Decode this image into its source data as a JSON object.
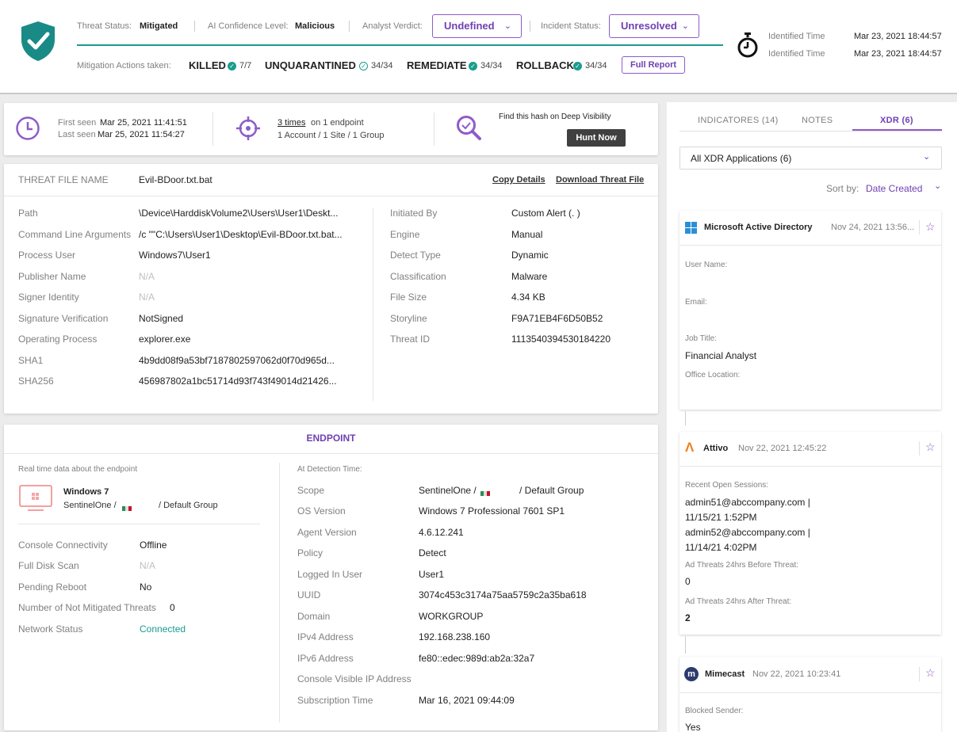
{
  "header": {
    "threat_status_label": "Threat Status:",
    "threat_status_value": "Mitigated",
    "ai_confidence_label": "AI Confidence Level:",
    "ai_confidence_value": "Malicious",
    "analyst_verdict_label": "Analyst Verdict:",
    "analyst_verdict_value": "Undefined",
    "incident_status_label": "Incident Status:",
    "incident_status_value": "Unresolved",
    "mitigation_label": "Mitigation Actions taken:",
    "mitigations": [
      {
        "name": "KILLED",
        "count": "7/7"
      },
      {
        "name": "UNQUARANTINED",
        "count": "34/34"
      },
      {
        "name": "REMEDIATE",
        "count": "34/34"
      },
      {
        "name": "ROLLBACK",
        "count": "34/34"
      }
    ],
    "full_report_label": "Full Report",
    "identified_label_1": "Identified Time",
    "identified_value_1": "Mar 23, 2021 18:44:57",
    "identified_label_2": "Identified Time",
    "identified_value_2": "Mar 23, 2021 18:44:57"
  },
  "summary": {
    "first_seen_label": "First seen",
    "first_seen_value": "Mar 25, 2021 11:41:51",
    "last_seen_label": "Last seen",
    "last_seen_value": "Mar 25, 2021 11:54:27",
    "times_link": "3 times",
    "times_suffix": "on 1 endpoint",
    "scope_line": "1 Account / 1 Site / 1 Group",
    "deep_visibility_text": "Find this hash on Deep Visibility",
    "hunt_now_label": "Hunt Now"
  },
  "threat_file": {
    "name_label": "THREAT FILE NAME",
    "name_value": "Evil-BDoor.txt.bat",
    "copy_details": "Copy Details",
    "download_file": "Download Threat File",
    "left_rows": [
      {
        "label": "Path",
        "value": "\\Device\\HarddiskVolume2\\Users\\User1\\Deskt..."
      },
      {
        "label": "Command Line Arguments",
        "value": "/c \"\"C:\\Users\\User1\\Desktop\\Evil-BDoor.txt.bat..."
      },
      {
        "label": "Process User",
        "value": "Windows7\\User1"
      },
      {
        "label": "Publisher Name",
        "value": "N/A"
      },
      {
        "label": "Signer Identity",
        "value": "N/A"
      },
      {
        "label": "Signature Verification",
        "value": "NotSigned"
      },
      {
        "label": "Operating Process",
        "value": "explorer.exe"
      },
      {
        "label": "SHA1",
        "value": "4b9dd08f9a53bf7187802597062d0f70d965d..."
      },
      {
        "label": "SHA256",
        "value": "456987802a1bc51714d93f743f49014d21426..."
      }
    ],
    "right_rows": [
      {
        "label": "Initiated By",
        "value": "Custom Alert (.                    )"
      },
      {
        "label": "Engine",
        "value": "Manual"
      },
      {
        "label": "Detect Type",
        "value": "Dynamic"
      },
      {
        "label": "Classification",
        "value": "Malware"
      },
      {
        "label": "File Size",
        "value": "4.34 KB"
      },
      {
        "label": "Storyline",
        "value": "F9A71EB4F6D50B52"
      },
      {
        "label": "Threat ID",
        "value": "1113540394530184220"
      }
    ]
  },
  "endpoint": {
    "title": "ENDPOINT",
    "realtime_label": "Real time data about the endpoint",
    "os_name": "Windows 7",
    "site_prefix": "SentinelOne /",
    "site_suffix": "/ Default Group",
    "left_rows": [
      {
        "label": "Console Connectivity",
        "value": "Offline"
      },
      {
        "label": "Full Disk Scan",
        "value": "N/A"
      },
      {
        "label": "Pending Reboot",
        "value": "No"
      },
      {
        "label": "Number of Not Mitigated Threats",
        "value": "0"
      },
      {
        "label": "Network Status",
        "value": "Connected"
      }
    ],
    "detection_label": "At Detection Time:",
    "right_rows": [
      {
        "label": "Scope",
        "value": "SentinelOne /"
      },
      {
        "label": "OS Version",
        "value": "Windows 7 Professional 7601 SP1"
      },
      {
        "label": "Agent Version",
        "value": "4.6.12.241"
      },
      {
        "label": "Policy",
        "value": "Detect"
      },
      {
        "label": "Logged In User",
        "value": "User1"
      },
      {
        "label": "UUID",
        "value": "3074c453c3174a75aa5759c2a35ba618"
      },
      {
        "label": "Domain",
        "value": "WORKGROUP"
      },
      {
        "label": "IPv4 Address",
        "value": "192.168.238.160"
      },
      {
        "label": "IPv6 Address",
        "value": "fe80::edec:989d:ab2a:32a7"
      },
      {
        "label": "Console Visible IP Address",
        "value": ""
      },
      {
        "label": "Subscription Time",
        "value": "Mar 16, 2021 09:44:09"
      }
    ],
    "scope_suffix": "/ Default Group"
  },
  "side": {
    "tabs": [
      "INDICATORES (14)",
      "NOTES",
      "XDR (6)"
    ],
    "filter_value": "All XDR Applications (6)",
    "sort_label": "Sort by:",
    "sort_value": "Date Created",
    "cards": [
      {
        "app": "Microsoft Active Directory",
        "date": "Nov 24, 2021 13:56...",
        "fields": [
          {
            "label": "User Name:",
            "value": ""
          },
          {
            "label": "Email:",
            "value": ""
          },
          {
            "label": "Job Title:",
            "value": "Financial Analyst"
          },
          {
            "label": "Office Location:",
            "value": ""
          }
        ]
      },
      {
        "app": "Attivo",
        "date": "Nov 22, 2021 12:45:22",
        "sessions_label": "Recent Open Sessions:",
        "sessions": [
          "admin51@abccompany.com |",
          "11/15/21 1:52PM",
          "admin52@abccompany.com |",
          "11/14/21 4:02PM"
        ],
        "before_label": "Ad Threats 24hrs Before Threat:",
        "before_value": "0",
        "after_label": "Ad Threats 24hrs After Threat:",
        "after_value": "2"
      },
      {
        "app": "Mimecast",
        "date": "Nov 22, 2021 10:23:41",
        "blocked_label": "Blocked Sender:",
        "blocked_value": "Yes"
      }
    ]
  }
}
